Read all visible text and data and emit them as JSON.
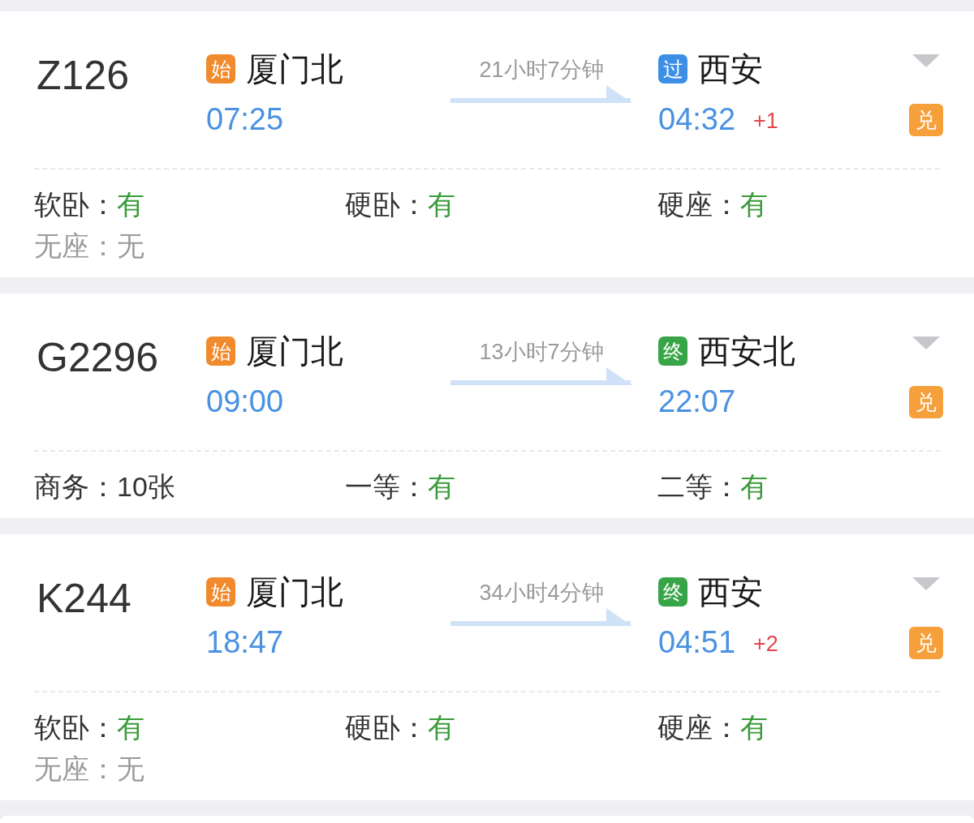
{
  "trains": [
    {
      "number": "Z126",
      "origin": {
        "kind": "start",
        "badge": "始",
        "station": "厦门北",
        "time": "07:25"
      },
      "duration": "21小时7分钟",
      "destination": {
        "kind": "pass",
        "badge": "过",
        "station": "西安",
        "time": "04:32",
        "day_offset": "+1"
      },
      "redeem_badge": "兑",
      "seats": [
        {
          "kind": "available",
          "label": "软卧：",
          "value": "有"
        },
        {
          "kind": "available",
          "label": "硬卧：",
          "value": "有"
        },
        {
          "kind": "available",
          "label": "硬座：",
          "value": "有"
        },
        {
          "kind": "none",
          "label": "无座：",
          "value": "无"
        }
      ]
    },
    {
      "number": "G2296",
      "origin": {
        "kind": "start",
        "badge": "始",
        "station": "厦门北",
        "time": "09:00"
      },
      "duration": "13小时7分钟",
      "destination": {
        "kind": "end",
        "badge": "终",
        "station": "西安北",
        "time": "22:07"
      },
      "redeem_badge": "兑",
      "seats": [
        {
          "kind": "count",
          "label": "商务：",
          "value": "10张"
        },
        {
          "kind": "available",
          "label": "一等：",
          "value": "有"
        },
        {
          "kind": "available",
          "label": "二等：",
          "value": "有"
        }
      ]
    },
    {
      "number": "K244",
      "origin": {
        "kind": "start",
        "badge": "始",
        "station": "厦门北",
        "time": "18:47"
      },
      "duration": "34小时4分钟",
      "destination": {
        "kind": "end",
        "badge": "终",
        "station": "西安",
        "time": "04:51",
        "day_offset": "+2"
      },
      "redeem_badge": "兑",
      "seats": [
        {
          "kind": "available",
          "label": "软卧：",
          "value": "有"
        },
        {
          "kind": "available",
          "label": "硬卧：",
          "value": "有"
        },
        {
          "kind": "available",
          "label": "硬座：",
          "value": "有"
        },
        {
          "kind": "none",
          "label": "无座：",
          "value": "无"
        }
      ]
    }
  ]
}
